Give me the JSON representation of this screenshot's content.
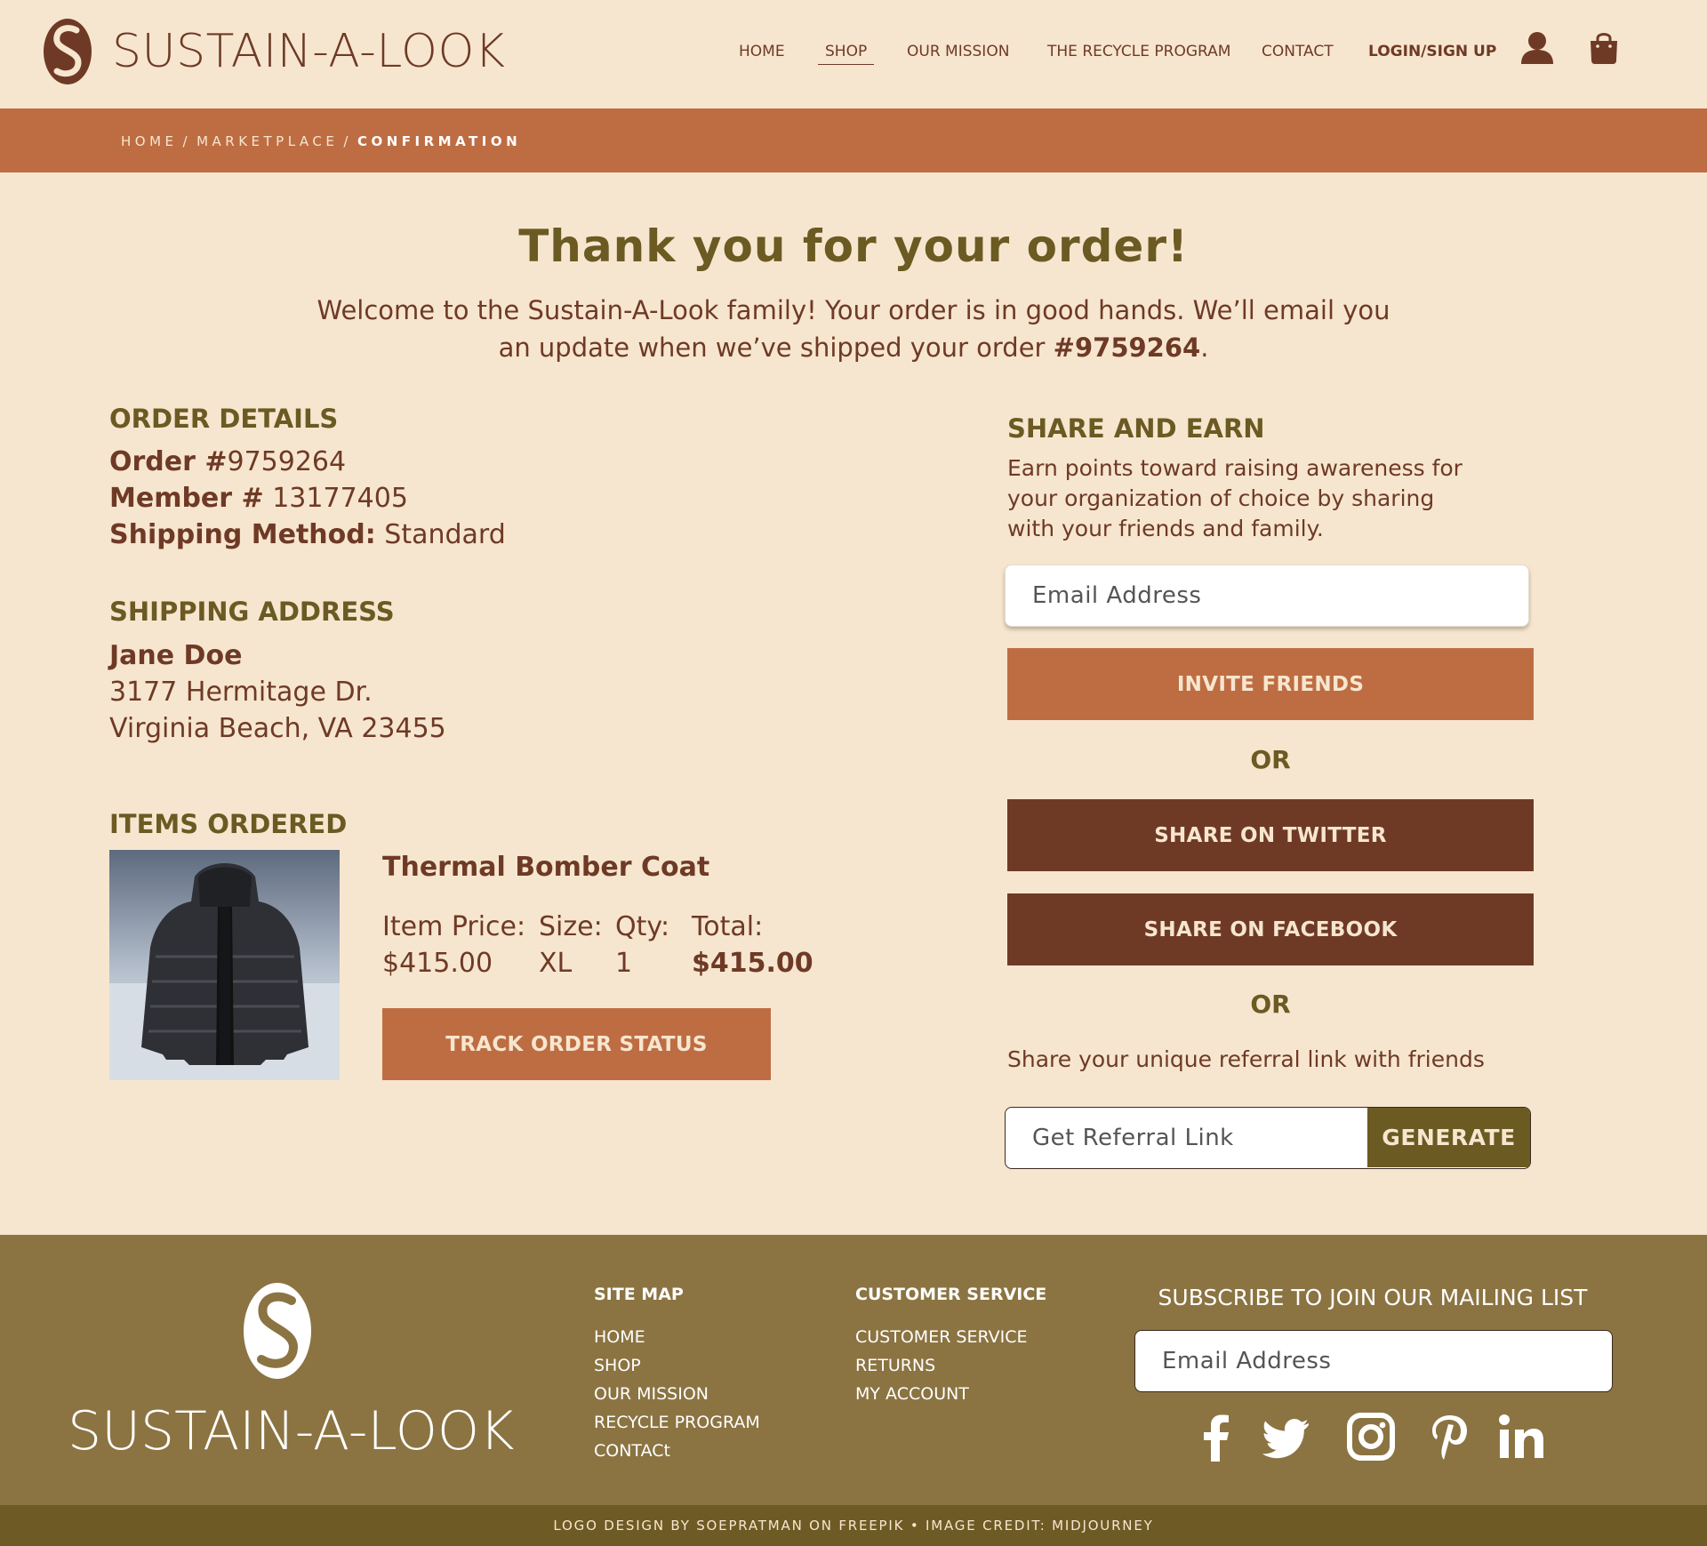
{
  "brand": {
    "name_part1": "SUSTAIN",
    "name_part2": "-A-LOOK"
  },
  "nav": {
    "home": "HOME",
    "shop": "SHOP",
    "mission": "OUR MISSION",
    "recycle": "THE RECYCLE PROGRAM",
    "contact": "CONTACT",
    "login": "LOGIN/SIGN UP",
    "icons": [
      "user-icon",
      "shopping-bag-icon"
    ]
  },
  "breadcrumb": {
    "home": "HOME",
    "marketplace": "MARKETPLACE",
    "current": "CONFIRMATION",
    "separator": "/"
  },
  "hero": {
    "title": "Thank you for your order!",
    "line1": "Welcome to the Sustain-A-Look family! Your order is in good hands. We’ll email you",
    "line2_prefix": "an update when we’ve shipped your order ",
    "order_ref": "#9759264",
    "line2_suffix": "."
  },
  "order_details": {
    "heading": "ORDER DETAILS",
    "order_label": "Order #",
    "order_number": "9759264",
    "member_label": "Member #",
    "member_number": "13177405",
    "shipping_label": "Shipping Method:",
    "shipping_method": "Standard"
  },
  "shipping_address": {
    "heading": "SHIPPING ADDRESS",
    "name": "Jane Doe",
    "street": "3177 Hermitage Dr.",
    "city_state_zip": "Virginia Beach, VA 23455"
  },
  "items": {
    "heading": "ITEMS ORDERED",
    "list": [
      {
        "name": "Thermal Bomber Coat",
        "price_label": "Item Price:",
        "price": "$415.00",
        "size_label": "Size:",
        "size": "XL",
        "qty_label": "Qty:",
        "qty": "1",
        "total_label": "Total:",
        "total": "$415.00"
      }
    ],
    "track_button": "TRACK ORDER STATUS"
  },
  "share": {
    "heading": "SHARE AND EARN",
    "description": "Earn points toward raising awareness for your organization of choice by sharing with your friends and family.",
    "email_placeholder": "Email Address",
    "invite_button": "INVITE FRIENDS",
    "or_text": "OR",
    "twitter_button": "SHARE ON TWITTER",
    "facebook_button": "SHARE ON FACEBOOK",
    "referral_text": "Share your unique referral link with friends",
    "referral_placeholder": "Get Referral Link",
    "generate_button": "GENERATE"
  },
  "footer": {
    "site_map": {
      "heading": "SITE MAP",
      "links": [
        "HOME",
        "SHOP",
        "OUR MISSION",
        "RECYCLE PROGRAM",
        "CONTACt"
      ]
    },
    "customer_service": {
      "heading": "CUSTOMER SERVICE",
      "links": [
        "CUSTOMER SERVICE",
        "RETURNS",
        "MY ACCOUNT"
      ]
    },
    "subscribe_heading": "SUBSCRIBE TO JOIN OUR MAILING LIST",
    "email_placeholder": "Email Address",
    "social_icons": [
      "facebook-icon",
      "twitter-icon",
      "instagram-icon",
      "pinterest-icon",
      "linkedin-icon"
    ],
    "credit": "LOGO DESIGN BY SOEPRATMAN ON FREEPIK • IMAGE CREDIT: MIDJOURNEY"
  },
  "colors": {
    "background": "#f7e6cf",
    "brown": "#6e3a26",
    "olive": "#6b5a22",
    "terracotta": "#be6d43",
    "footer": "#8b7442",
    "footer_bottom": "#6e5a24"
  }
}
